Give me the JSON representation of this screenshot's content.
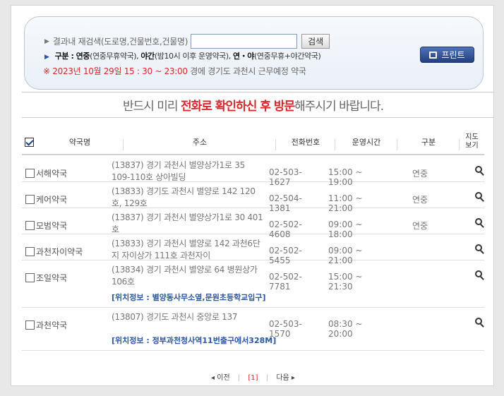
{
  "search": {
    "label": "결과내 재검색(도로명,건물번호,건물명)",
    "input_value": "",
    "input_placeholder": "",
    "button": "검색"
  },
  "legend": {
    "prefix": "구분 :",
    "item1_bold": "연중",
    "item1_desc": "(연중무휴약국),",
    "item2_bold": "야간",
    "item2_desc": "(밤10시 이후 운영약국),",
    "item3_bold": "연・야",
    "item3_desc": "(연중무휴+야간약국)"
  },
  "schedule": {
    "date_text": "※ 2023년 10월 29일 15 : 30 ~ 23:00",
    "rest_text": " 경에   경기도   과천시   근무예정 약국"
  },
  "print_button": "프린트",
  "notice": {
    "part1": "반드시 미리 ",
    "red1": "전화로 확인하신 후 방문",
    "part2": "해주시기 바랍니다."
  },
  "table": {
    "headers": {
      "name": "약국명",
      "addr": "주소",
      "tel": "전화번호",
      "hours": "운영시간",
      "type": "구분",
      "map_line1": "지도",
      "map_line2": "보기"
    },
    "rows": [
      {
        "name": "서해약국",
        "addr": "(13837) 경기 과천시 별양상가1로 35 109-110호 상아빌딩",
        "tel": "02-503-1627",
        "hours": "15:00 ~ 19:00",
        "type": "연중",
        "loc": ""
      },
      {
        "name": "케어약국",
        "addr": "(13833) 경기도 과천시 별양로 142 120호, 129호",
        "tel": "02-504-1381",
        "hours": "11:00 ~ 21:00",
        "type": "연중",
        "loc": ""
      },
      {
        "name": "모범약국",
        "addr": "(13837) 경기 과천시 별양상가1로 30 401호",
        "tel": "02-502-4608",
        "hours": "09:00 ~ 18:00",
        "type": "연중",
        "loc": ""
      },
      {
        "name": "과천자이약국",
        "addr": "(13833) 경기 과천시 별양로 142 과천6단지 자이상가 111호 과천자이",
        "tel": "02-502-5455",
        "hours": "09:00 ~ 21:00",
        "type": "",
        "loc": ""
      },
      {
        "name": "조일약국",
        "addr": "(13834) 경기 과천시 별양로 64 병원상가 106호",
        "tel": "02-502-7781",
        "hours": "15:00 ~ 21:30",
        "type": "",
        "loc": "[위치정보 : 별양동사무소옆,문원초등학교입구]"
      },
      {
        "name": "과천약국",
        "addr": "(13807) 경기도 과천시 중앙로 137",
        "tel": "02-503-1570",
        "hours": "08:30 ~ 20:00",
        "type": "",
        "loc": "[위치정보 : 정부과천청사역11번출구에서328M]"
      }
    ]
  },
  "pager": {
    "prev": "◂ 이전",
    "current": "[1]",
    "next": "다음 ▸"
  }
}
